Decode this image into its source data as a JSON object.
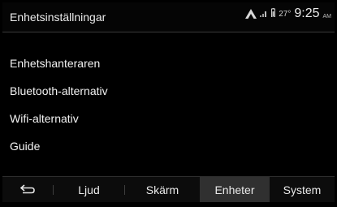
{
  "header": {
    "title": "Enhetsinställningar",
    "temperature": "27°",
    "time": "9:25",
    "ampm": "AM"
  },
  "menu": {
    "items": [
      {
        "label": "Enhetshanteraren"
      },
      {
        "label": "Bluetooth-alternativ"
      },
      {
        "label": "Wifi-alternativ"
      },
      {
        "label": "Guide"
      }
    ]
  },
  "tabs": {
    "back_icon": "back-arrow-icon",
    "items": [
      {
        "label": "Ljud"
      },
      {
        "label": "Skärm"
      },
      {
        "label": "Enheter",
        "active": true
      },
      {
        "label": "System"
      }
    ]
  },
  "colors": {
    "background": "#000000",
    "active_tab": "#303030",
    "text": "#ffffff"
  }
}
